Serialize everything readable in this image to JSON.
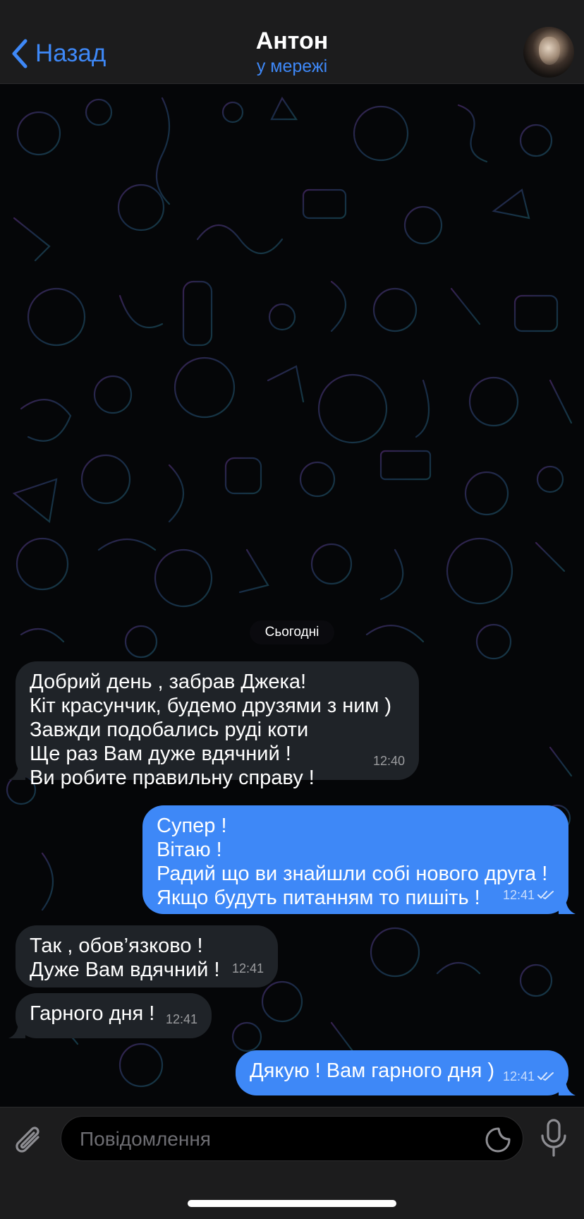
{
  "header": {
    "back_label": "Назад",
    "contact_name": "Антон",
    "contact_status": "у мережі"
  },
  "chat": {
    "date_separator": "Сьогодні",
    "messages": [
      {
        "direction": "incoming",
        "lines": [
          "Добрий день , забрав Джека!",
          "Кіт красунчик, будемо друзями з ним )",
          "Завжди подобались руді коти",
          "Ще раз Вам дуже вдячний !",
          "Ви робите правильну справу !"
        ],
        "time": "12:40"
      },
      {
        "direction": "outgoing",
        "lines": [
          "Супер !",
          "Вітаю !",
          "Радий що ви знайшли собі нового друга !",
          "Якщо будуть питанням то пишіть !"
        ],
        "time": "12:41",
        "read": true
      },
      {
        "direction": "incoming",
        "lines": [
          "Так , обов’язково !",
          "Дуже Вам вдячний !"
        ],
        "time": "12:41"
      },
      {
        "direction": "incoming",
        "lines": [
          "Гарного дня !"
        ],
        "time": "12:41"
      },
      {
        "direction": "outgoing",
        "lines": [
          "Дякую ! Вам гарного дня )"
        ],
        "time": "12:41",
        "read": true
      }
    ]
  },
  "input": {
    "placeholder": "Повідомлення"
  },
  "colors": {
    "accent": "#3e88f7",
    "incoming_bubble": "#1f2328",
    "outgoing_bubble": "#3e88f7",
    "bar_background": "#1c1c1d"
  },
  "icons": {
    "back": "chevron-left-icon",
    "attach": "paperclip-icon",
    "sticker": "sticker-icon",
    "mic": "microphone-icon"
  }
}
